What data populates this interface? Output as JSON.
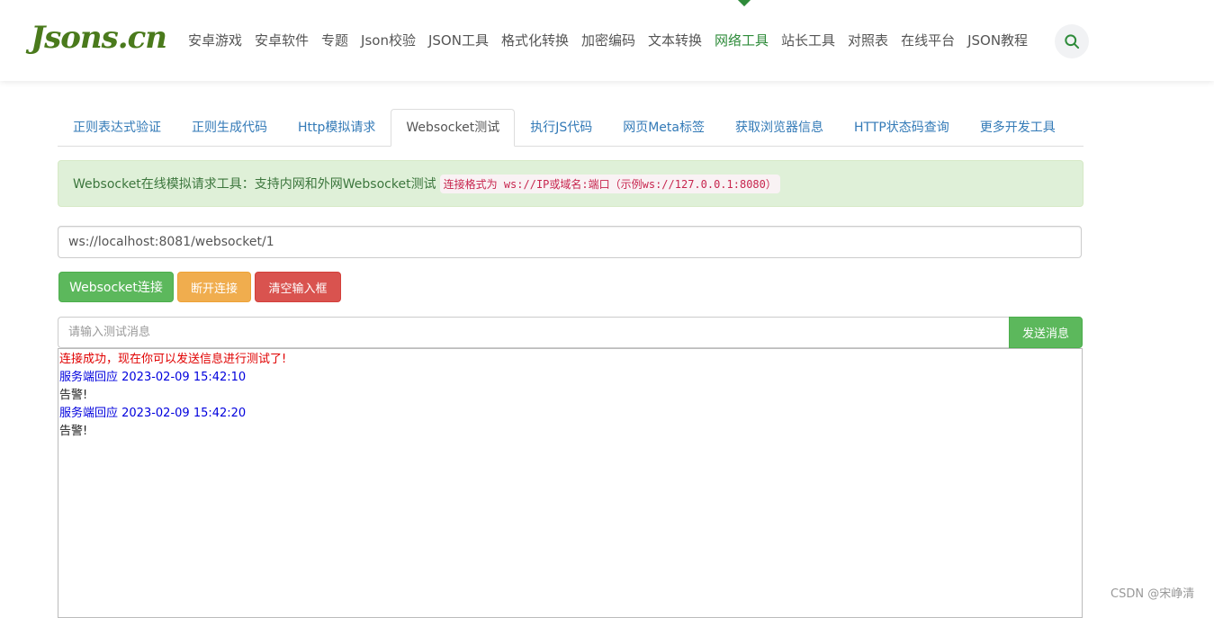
{
  "header": {
    "logo": "Jsons.cn",
    "nav": [
      {
        "label": "安卓游戏",
        "active": false
      },
      {
        "label": "安卓软件",
        "active": false
      },
      {
        "label": "专题",
        "active": false
      },
      {
        "label": "Json校验",
        "active": false
      },
      {
        "label": "JSON工具",
        "active": false
      },
      {
        "label": "格式化转换",
        "active": false
      },
      {
        "label": "加密编码",
        "active": false
      },
      {
        "label": "文本转换",
        "active": false
      },
      {
        "label": "网络工具",
        "active": true
      },
      {
        "label": "站长工具",
        "active": false
      },
      {
        "label": "对照表",
        "active": false
      },
      {
        "label": "在线平台",
        "active": false
      },
      {
        "label": "JSON教程",
        "active": false
      }
    ],
    "search_icon": "search-icon",
    "accent_color": "#2e8b3a"
  },
  "tabs": [
    {
      "label": "正则表达式验证",
      "active": false
    },
    {
      "label": "正则生成代码",
      "active": false
    },
    {
      "label": "Http模拟请求",
      "active": false
    },
    {
      "label": "Websocket测试",
      "active": true
    },
    {
      "label": "执行JS代码",
      "active": false
    },
    {
      "label": "网页Meta标签",
      "active": false
    },
    {
      "label": "获取浏览器信息",
      "active": false
    },
    {
      "label": "HTTP状态码查询",
      "active": false
    },
    {
      "label": "更多开发工具",
      "active": false
    }
  ],
  "alert": {
    "text": "Websocket在线模拟请求工具：支持内网和外网Websocket测试",
    "code": "连接格式为 ws://IP或域名:端口（示例ws://127.0.0.1:8080）"
  },
  "url_input": {
    "value": "ws://localhost:8081/websocket/1"
  },
  "buttons": {
    "connect": "Websocket连接",
    "disconnect": "断开连接",
    "clear": "清空输入框",
    "send": "发送消息"
  },
  "message_input": {
    "placeholder": "请输入测试消息"
  },
  "log": [
    {
      "type": "ok",
      "text": "连接成功，现在你可以发送信息进行测试了!"
    },
    {
      "type": "server",
      "text": "服务端回应 2023-02-09 15:42:10"
    },
    {
      "type": "text",
      "text": "告警!"
    },
    {
      "type": "server",
      "text": "服务端回应 2023-02-09 15:42:20"
    },
    {
      "type": "text",
      "text": "告警!"
    }
  ],
  "watermark": "CSDN @宋峥清"
}
